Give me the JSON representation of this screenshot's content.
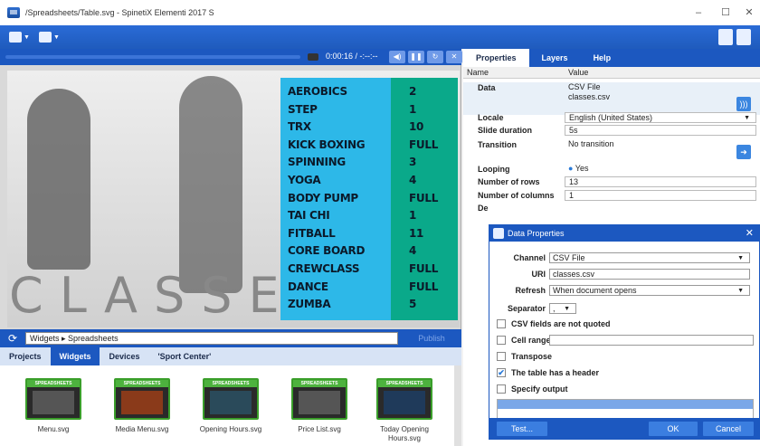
{
  "window": {
    "title": "/Spreadsheets/Table.svg - SpinetiX Elementi 2017 S",
    "controls": [
      "–",
      "☐",
      "✕"
    ]
  },
  "player": {
    "time": "0:00:16 / -:--:--",
    "buttons": [
      "◀)",
      "❚❚",
      "↻",
      "✕"
    ]
  },
  "slide": {
    "background_word": "CLASSES",
    "rows": [
      {
        "name": "AEROBICS",
        "value": "2"
      },
      {
        "name": "STEP",
        "value": "1"
      },
      {
        "name": "TRX",
        "value": "10"
      },
      {
        "name": "KICK BOXING",
        "value": "FULL"
      },
      {
        "name": "SPINNING",
        "value": "3"
      },
      {
        "name": "YOGA",
        "value": "4"
      },
      {
        "name": "BODY PUMP",
        "value": "FULL"
      },
      {
        "name": "TAI CHI",
        "value": "1"
      },
      {
        "name": "FITBALL",
        "value": "11"
      },
      {
        "name": "CORE BOARD",
        "value": "4"
      },
      {
        "name": "CREWCLASS",
        "value": "FULL"
      },
      {
        "name": "DANCE",
        "value": "FULL"
      },
      {
        "name": "ZUMBA",
        "value": "5"
      }
    ]
  },
  "widgets_bar": {
    "path": "Widgets ▸ Spreadsheets",
    "publish": "Publish"
  },
  "bottom_tabs": [
    "Projects",
    "Widgets",
    "Devices",
    "'Sport Center'"
  ],
  "widgets": [
    {
      "label": "Menu.svg",
      "thumb": "SPREADSHEETS"
    },
    {
      "label": "Media Menu.svg",
      "thumb": "SPREADSHEETS"
    },
    {
      "label": "Opening Hours.svg",
      "thumb": "SPREADSHEETS"
    },
    {
      "label": "Price List.svg",
      "thumb": "SPREADSHEETS"
    },
    {
      "label": "Today Opening Hours.svg",
      "thumb": "SPREADSHEETS"
    }
  ],
  "right_tabs": [
    "Properties",
    "Layers",
    "Help"
  ],
  "properties": {
    "col_name": "Name",
    "col_value": "Value",
    "data_label": "Data",
    "data_value1": "CSV File",
    "data_value2": "classes.csv",
    "locale_label": "Locale",
    "locale_value": "English (United States)",
    "slide_duration_label": "Slide duration",
    "slide_duration_value": "5s",
    "transition_label": "Transition",
    "transition_value": "No transition",
    "looping_label": "Looping",
    "looping_value": "Yes",
    "rows_label": "Number of rows",
    "rows_value": "13",
    "cols_label": "Number of columns",
    "cols_value": "1",
    "de_label": "De"
  },
  "dialog": {
    "title": "Data Properties",
    "channel_label": "Channel",
    "channel_value": "CSV File",
    "uri_label": "URI",
    "uri_value": "classes.csv",
    "refresh_label": "Refresh",
    "refresh_value": "When document opens",
    "separator_label": "Separator",
    "separator_value": ",",
    "chk_quoted": "CSV fields are not quoted",
    "chk_cell_range": "Cell range",
    "chk_transpose": "Transpose",
    "chk_header": "The table has a header",
    "chk_output": "Specify output",
    "btn_test": "Test...",
    "btn_ok": "OK",
    "btn_cancel": "Cancel"
  }
}
